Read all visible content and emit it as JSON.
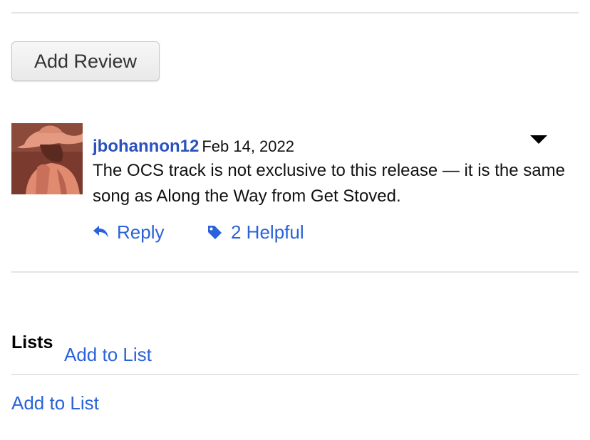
{
  "review_section": {
    "add_review_label": "Add Review"
  },
  "review": {
    "username": "jbohannon12",
    "date": "Feb 14, 2022",
    "text": "The OCS track is not exclusive to this release — it is the same song as Along the Way from Get Stoved.",
    "reply_label": "Reply",
    "helpful_label": "2 Helpful",
    "menu_icon": "caret-down-icon",
    "avatar_icon": "cowboy-photo"
  },
  "lists": {
    "heading": "Lists",
    "inline_add_label": "Add to List",
    "add_label": "Add to List"
  },
  "colors": {
    "link": "#2a62d9",
    "username": "#2a52be",
    "divider": "#e5e5e5"
  }
}
